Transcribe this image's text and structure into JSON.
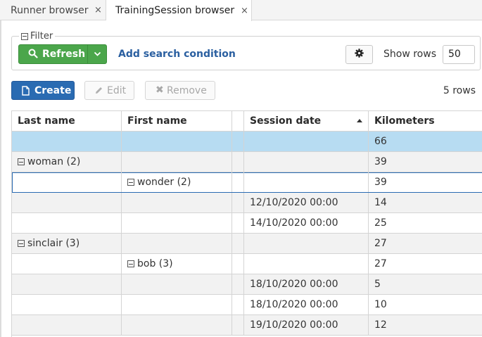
{
  "tabs": [
    {
      "label": "Runner browser",
      "close": "×"
    },
    {
      "label": "TrainingSession browser",
      "close": "×"
    }
  ],
  "filter": {
    "legend": "Filter",
    "refresh_label": "Refresh",
    "add_condition_label": "Add search condition",
    "show_rows_label": "Show rows",
    "rows_value": "50"
  },
  "actions": {
    "create_label": "Create",
    "edit_label": "Edit",
    "remove_label": "Remove",
    "row_count": "5 rows"
  },
  "grid": {
    "columns": [
      "Last name",
      "First name",
      "",
      "Session date",
      "Kilometers"
    ],
    "sorted_column": "Session date",
    "rows": [
      {
        "last": "",
        "first": "",
        "date": "",
        "km": "66",
        "last_group": false,
        "first_group": false
      },
      {
        "last": "woman (2)",
        "first": "",
        "date": "",
        "km": "39",
        "last_group": true,
        "first_group": false
      },
      {
        "last": "",
        "first": "wonder (2)",
        "date": "",
        "km": "39",
        "last_group": false,
        "first_group": true
      },
      {
        "last": "",
        "first": "",
        "date": "12/10/2020 00:00",
        "km": "14",
        "last_group": false,
        "first_group": false
      },
      {
        "last": "",
        "first": "",
        "date": "14/10/2020 00:00",
        "km": "25",
        "last_group": false,
        "first_group": false
      },
      {
        "last": "sinclair (3)",
        "first": "",
        "date": "",
        "km": "27",
        "last_group": true,
        "first_group": false
      },
      {
        "last": "",
        "first": "bob (3)",
        "date": "",
        "km": "27",
        "last_group": false,
        "first_group": true
      },
      {
        "last": "",
        "first": "",
        "date": "18/10/2020 00:00",
        "km": "5",
        "last_group": false,
        "first_group": false
      },
      {
        "last": "",
        "first": "",
        "date": "18/10/2020 00:00",
        "km": "10",
        "last_group": false,
        "first_group": false
      },
      {
        "last": "",
        "first": "",
        "date": "19/10/2020 00:00",
        "km": "12",
        "last_group": false,
        "first_group": false
      }
    ]
  },
  "colors": {
    "refresh_green": "#4ba64b",
    "create_blue": "#2a6bb2",
    "link_blue": "#2a5fa0",
    "selected_row": "#b7dcf2"
  }
}
